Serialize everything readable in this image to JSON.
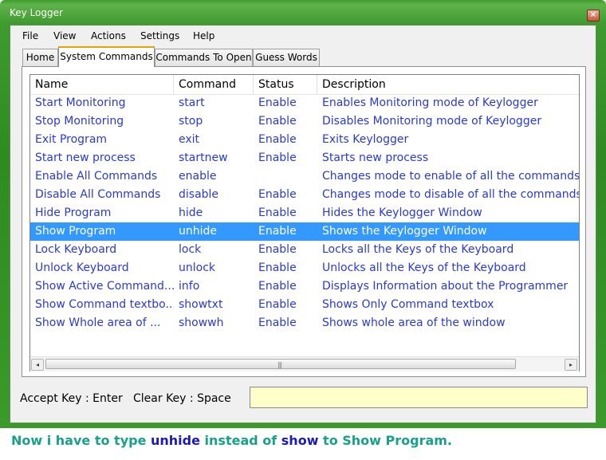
{
  "window": {
    "title": "Key Logger",
    "close_glyph": "×",
    "close_icon": "close-icon"
  },
  "menu": [
    "File",
    "View",
    "Actions",
    "Settings",
    "Help"
  ],
  "tabs": [
    {
      "label": "Home",
      "active": false
    },
    {
      "label": "System Commands",
      "active": true
    },
    {
      "label": "Commands To Open",
      "active": false
    },
    {
      "label": "Guess Words",
      "active": false
    }
  ],
  "table": {
    "columns": [
      "Name",
      "Command",
      "Status",
      "Description"
    ],
    "selected_row": 7,
    "rows": [
      {
        "name": "Start Monitoring",
        "command": "start",
        "status": "Enable",
        "description": "Enables Monitoring mode of Keylogger"
      },
      {
        "name": "Stop Monitoring",
        "command": "stop",
        "status": "Enable",
        "description": "Disables Monitoring mode of Keylogger"
      },
      {
        "name": "Exit Program",
        "command": "exit",
        "status": "Enable",
        "description": "Exits Keylogger"
      },
      {
        "name": "Start new process",
        "command": "startnew",
        "status": "Enable",
        "description": "Starts new process"
      },
      {
        "name": "Enable All Commands",
        "command": "enable",
        "status": "",
        "description": "Changes mode to enable of all the commands c"
      },
      {
        "name": "Disable All Commands",
        "command": "disable",
        "status": "Enable",
        "description": "Changes mode to disable of all the commands"
      },
      {
        "name": "Hide Program",
        "command": "hide",
        "status": "Enable",
        "description": "Hides the Keylogger Window"
      },
      {
        "name": "Show Program",
        "command": "unhide",
        "status": "Enable",
        "description": "Shows the Keylogger Window"
      },
      {
        "name": "Lock Keyboard",
        "command": "lock",
        "status": "Enable",
        "description": "Locks all the Keys of the Keyboard"
      },
      {
        "name": "Unlock Keyboard",
        "command": "unlock",
        "status": "Enable",
        "description": "Unlocks all the Keys of the Keyboard"
      },
      {
        "name": "Show Active Command...",
        "command": "info",
        "status": "Enable",
        "description": "Displays Information about the Programmer"
      },
      {
        "name": "Show Command textbo...",
        "command": "showtxt",
        "status": "Enable",
        "description": "Shows Only Command textbox"
      },
      {
        "name": "Show Whole area of ...",
        "command": "showwh",
        "status": "Enable",
        "description": "Shows whole area of the window"
      }
    ]
  },
  "scrollbar": {
    "left_arrow": "◂",
    "right_arrow": "▸",
    "grip": "|||"
  },
  "bottom": {
    "accept_key": "Accept Key : Enter",
    "clear_key": "Clear Key : Space",
    "command_value": ""
  },
  "caption": {
    "part1": "Now i have to type ",
    "kw1": "unhide",
    "part2": " instead of ",
    "kw2": "show",
    "part3": " to Show Program."
  },
  "colors": {
    "row_text": "#2a3ad0",
    "selection": "#3399ff",
    "caption": "#17a08a",
    "caption_keyword": "#1a1ab8",
    "input_bg": "#ffffcc"
  }
}
